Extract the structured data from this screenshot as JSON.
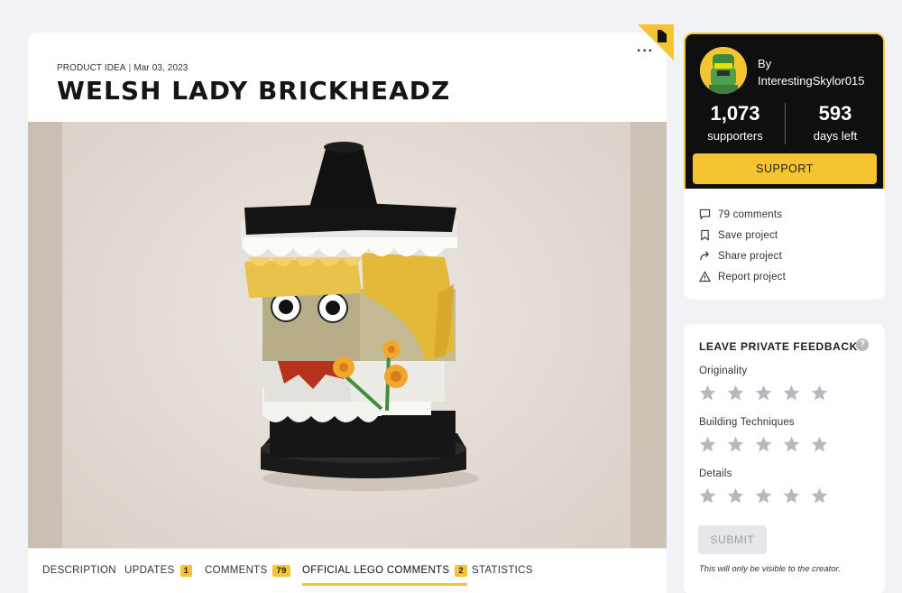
{
  "project": {
    "category": "PRODUCT IDEA",
    "date": "Mar 03, 2023",
    "title": "WELSH LADY BRICKHEADZ",
    "more_label": "···"
  },
  "tabs": [
    {
      "label": "DESCRIPTION",
      "badge": ""
    },
    {
      "label": "UPDATES",
      "badge": "1"
    },
    {
      "label": "COMMENTS",
      "badge": "79"
    },
    {
      "label": "OFFICIAL LEGO COMMENTS",
      "badge": "2",
      "active": true
    },
    {
      "label": "STATISTICS",
      "badge": ""
    }
  ],
  "creator": {
    "by_label": "By",
    "username": "InterestingSkylor015",
    "supporters_count": "1,073",
    "supporters_label": "supporters",
    "days_count": "593",
    "days_label": "days left",
    "support_label": "SUPPORT"
  },
  "actions": [
    {
      "label": "79 comments",
      "icon": "comment-icon"
    },
    {
      "label": "Save project",
      "icon": "bookmark-icon"
    },
    {
      "label": "Share project",
      "icon": "share-icon"
    },
    {
      "label": "Report project",
      "icon": "warning-icon"
    }
  ],
  "feedback": {
    "title": "LEAVE PRIVATE FEEDBACK",
    "help": "?",
    "criteria": [
      "Originality",
      "Building Techniques",
      "Details"
    ],
    "submit_label": "SUBMIT",
    "note": "This will only be visible to the creator."
  },
  "colors": {
    "accent": "#f5c431",
    "dark": "#0f0f0f",
    "background": "#f1f2f6"
  }
}
